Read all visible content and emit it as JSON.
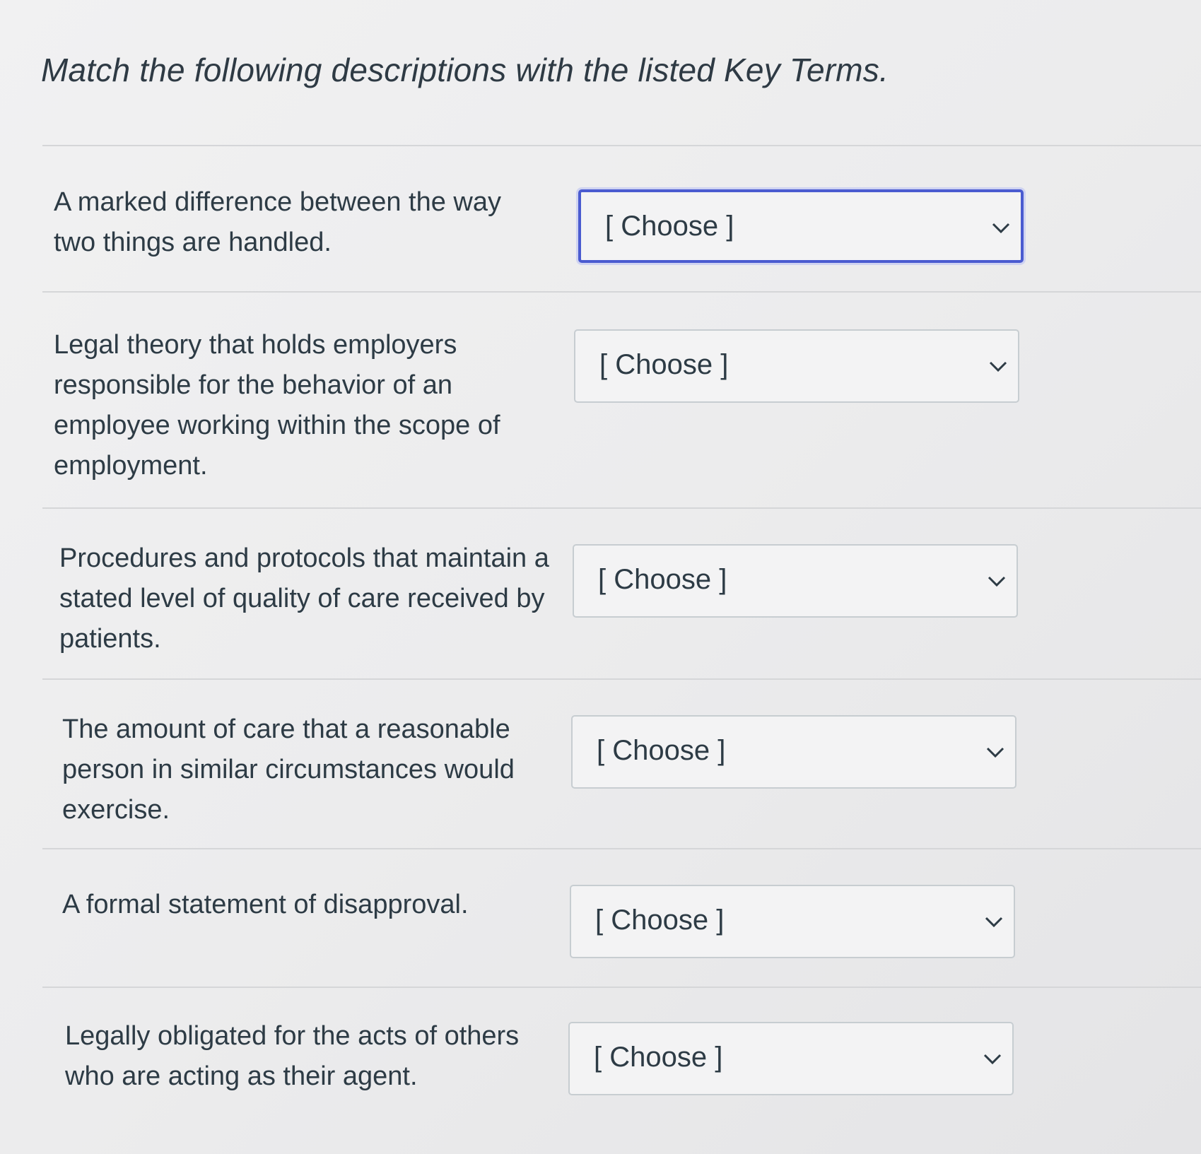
{
  "quiz": {
    "title": "Match the following descriptions with the listed Key Terms.",
    "select_placeholder": "[ Choose ]",
    "icons": {
      "dropdown": "chevron-down-icon"
    },
    "colors": {
      "focus_border": "#4a5bd0",
      "text": "#2d3b45",
      "border": "#c7cdd1"
    },
    "items": [
      {
        "description": "A marked difference between the way two things are handled.",
        "selected": "[ Choose ]",
        "focused": true
      },
      {
        "description": "Legal theory that holds employers responsible for the behavior of an employee working within the scope of employment.",
        "selected": "[ Choose ]",
        "focused": false
      },
      {
        "description": "Procedures and protocols that maintain a stated level of quality of care received by patients.",
        "selected": "[ Choose ]",
        "focused": false
      },
      {
        "description": "The amount of care that a reasonable person in similar circumstances would exercise.",
        "selected": "[ Choose ]",
        "focused": false
      },
      {
        "description": "A formal statement of disapproval.",
        "selected": "[ Choose ]",
        "focused": false
      },
      {
        "description": "Legally obligated for the acts of others who are acting as their agent.",
        "selected": "[ Choose ]",
        "focused": false
      }
    ]
  }
}
